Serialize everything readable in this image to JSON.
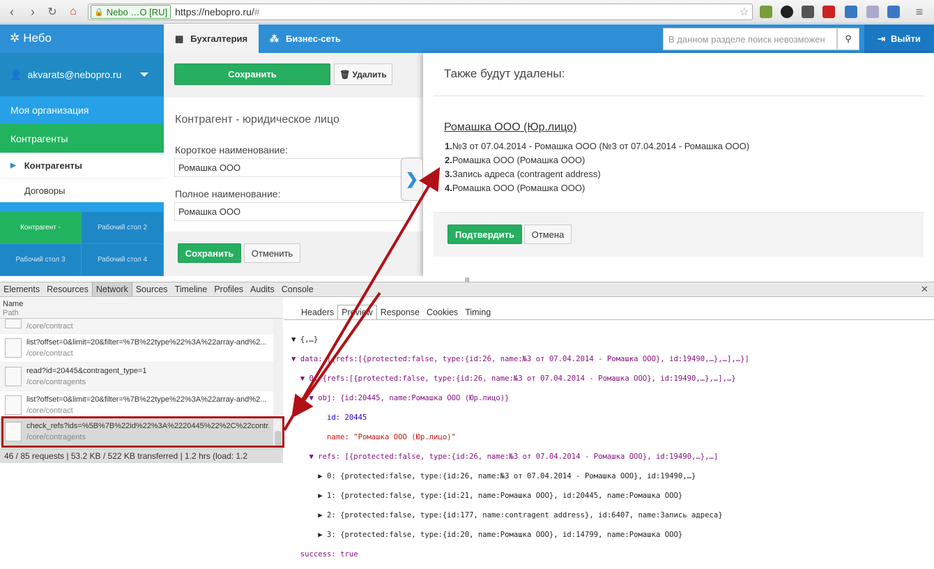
{
  "browser": {
    "secure_label": "Nebo …O [RU]",
    "url_main": "https://nebopro.ru/",
    "url_hash": "#"
  },
  "app": {
    "logo": "Небо",
    "tabs": [
      {
        "label": "Бухгалтерия"
      },
      {
        "label": "Бизнес-сеть"
      }
    ],
    "search_placeholder": "В данном разделе поиск невозможен",
    "logout": "Выйти",
    "accent": "#2e8fd6",
    "green": "#27ae60"
  },
  "sidebar": {
    "user": "akvarats@nebopro.ru",
    "my_org": "Моя организация",
    "contractors": "Контрагенты",
    "sub_items": [
      "Контрагенты",
      "Договоры"
    ],
    "desktops": [
      "Контрагент -",
      "Рабочий стол 2",
      "Рабочий стол 3",
      "Рабочий стол 4"
    ]
  },
  "form": {
    "save": "Сохранить",
    "delete": "Удалить",
    "title": "Контрагент - юридическое лицо",
    "short_label": "Короткое наименование:",
    "short_value": "Ромашка ООО",
    "full_label": "Полное наименование:",
    "full_value": "Ромашка ООО",
    "save2": "Сохранить",
    "cancel": "Отменить"
  },
  "modal": {
    "title": "Также будут удалены:",
    "link": "Ромашка ООО (Юр.лицо)",
    "items": [
      {
        "num": "1.",
        "text": "№3 от 07.04.2014 - Ромашка ООО (№3 от 07.04.2014 - Ромашка ООО)"
      },
      {
        "num": "2.",
        "text": "Ромашка ООО (Ромашка ООО)"
      },
      {
        "num": "3.",
        "text": "Запись адреса (contragent address)"
      },
      {
        "num": "4.",
        "text": "Ромашка ООО (Ромашка ООО)"
      }
    ],
    "confirm": "Подтвердить",
    "cancel": "Отмена"
  },
  "devtools": {
    "tabs": [
      "Elements",
      "Resources",
      "Network",
      "Sources",
      "Timeline",
      "Profiles",
      "Audits",
      "Console"
    ],
    "col_name": "Name",
    "col_path": "Path",
    "requests": [
      {
        "name": "",
        "path": "/core/contract"
      },
      {
        "name": "list?offset=0&limit=20&filter=%7B%22type%22%3A%22array-and%2...",
        "path": "/core/contract"
      },
      {
        "name": "read?id=20445&contragent_type=1",
        "path": "/core/contragents"
      },
      {
        "name": "list?offset=0&limit=20&filter=%7B%22type%22%3A%22array-and%2...",
        "path": "/core/contract"
      },
      {
        "name": "check_refs?ids=%5B%7B%22id%22%3A%2220445%22%2C%22contr...",
        "path": "/core/contragents"
      }
    ],
    "status": "46 / 85 requests  |  53.2 KB / 522 KB transferred  |  1.2 hrs (load: 1.2",
    "detail_tabs": [
      "Headers",
      "Preview",
      "Response",
      "Cookies",
      "Timing"
    ],
    "preview_lines": [
      "▼ {,…}",
      "▼ data: [{refs:[{protected:false, type:{id:26, name:№3 от 07.04.2014 - Ромашка ООО}, id:19490,…},…],…}]",
      "  ▼ 0: {refs:[{protected:false, type:{id:26, name:№3 от 07.04.2014 - Ромашка ООО}, id:19490,…},…],…}",
      "    ▼ obj: {id:20445, name:Ромашка ООО (Юр.лицо)}",
      "        id: 20445",
      "        name: \"Ромашка ООО (Юр.лицо)\"",
      "    ▼ refs: [{protected:false, type:{id:26, name:№3 от 07.04.2014 - Ромашка ООО}, id:19490,…},…]",
      "      ▶ 0: {protected:false, type:{id:26, name:№3 от 07.04.2014 - Ромашка ООО}, id:19490,…}",
      "      ▶ 1: {protected:false, type:{id:21, name:Ромашка ООО}, id:20445, name:Ромашка ООО}",
      "      ▶ 2: {protected:false, type:{id:177, name:contragent address}, id:6407, name:Запись адреса}",
      "      ▶ 3: {protected:false, type:{id:20, name:Ромашка ООО}, id:14799, name:Ромашка ООО}",
      "  success: true"
    ]
  }
}
